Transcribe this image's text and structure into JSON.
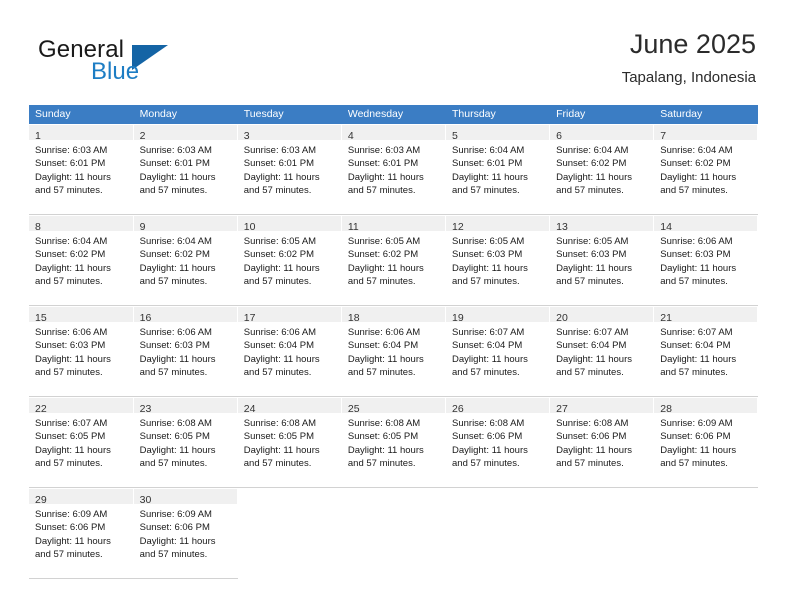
{
  "brand": {
    "name_top": "General",
    "name_bottom": "Blue",
    "flag_color": "#1464a5",
    "blue_color": "#1d7dc4"
  },
  "header": {
    "title": "June 2025",
    "subtitle": "Tapalang, Indonesia"
  },
  "calendar": {
    "header_bg": "#3b7dc4",
    "daynum_bg": "#f0f0f0",
    "weekday_headers": [
      "Sunday",
      "Monday",
      "Tuesday",
      "Wednesday",
      "Thursday",
      "Friday",
      "Saturday"
    ],
    "weeks": [
      [
        {
          "day": "1",
          "sunrise": "Sunrise: 6:03 AM",
          "sunset": "Sunset: 6:01 PM",
          "daylight1": "Daylight: 11 hours",
          "daylight2": "and 57 minutes."
        },
        {
          "day": "2",
          "sunrise": "Sunrise: 6:03 AM",
          "sunset": "Sunset: 6:01 PM",
          "daylight1": "Daylight: 11 hours",
          "daylight2": "and 57 minutes."
        },
        {
          "day": "3",
          "sunrise": "Sunrise: 6:03 AM",
          "sunset": "Sunset: 6:01 PM",
          "daylight1": "Daylight: 11 hours",
          "daylight2": "and 57 minutes."
        },
        {
          "day": "4",
          "sunrise": "Sunrise: 6:03 AM",
          "sunset": "Sunset: 6:01 PM",
          "daylight1": "Daylight: 11 hours",
          "daylight2": "and 57 minutes."
        },
        {
          "day": "5",
          "sunrise": "Sunrise: 6:04 AM",
          "sunset": "Sunset: 6:01 PM",
          "daylight1": "Daylight: 11 hours",
          "daylight2": "and 57 minutes."
        },
        {
          "day": "6",
          "sunrise": "Sunrise: 6:04 AM",
          "sunset": "Sunset: 6:02 PM",
          "daylight1": "Daylight: 11 hours",
          "daylight2": "and 57 minutes."
        },
        {
          "day": "7",
          "sunrise": "Sunrise: 6:04 AM",
          "sunset": "Sunset: 6:02 PM",
          "daylight1": "Daylight: 11 hours",
          "daylight2": "and 57 minutes."
        }
      ],
      [
        {
          "day": "8",
          "sunrise": "Sunrise: 6:04 AM",
          "sunset": "Sunset: 6:02 PM",
          "daylight1": "Daylight: 11 hours",
          "daylight2": "and 57 minutes."
        },
        {
          "day": "9",
          "sunrise": "Sunrise: 6:04 AM",
          "sunset": "Sunset: 6:02 PM",
          "daylight1": "Daylight: 11 hours",
          "daylight2": "and 57 minutes."
        },
        {
          "day": "10",
          "sunrise": "Sunrise: 6:05 AM",
          "sunset": "Sunset: 6:02 PM",
          "daylight1": "Daylight: 11 hours",
          "daylight2": "and 57 minutes."
        },
        {
          "day": "11",
          "sunrise": "Sunrise: 6:05 AM",
          "sunset": "Sunset: 6:02 PM",
          "daylight1": "Daylight: 11 hours",
          "daylight2": "and 57 minutes."
        },
        {
          "day": "12",
          "sunrise": "Sunrise: 6:05 AM",
          "sunset": "Sunset: 6:03 PM",
          "daylight1": "Daylight: 11 hours",
          "daylight2": "and 57 minutes."
        },
        {
          "day": "13",
          "sunrise": "Sunrise: 6:05 AM",
          "sunset": "Sunset: 6:03 PM",
          "daylight1": "Daylight: 11 hours",
          "daylight2": "and 57 minutes."
        },
        {
          "day": "14",
          "sunrise": "Sunrise: 6:06 AM",
          "sunset": "Sunset: 6:03 PM",
          "daylight1": "Daylight: 11 hours",
          "daylight2": "and 57 minutes."
        }
      ],
      [
        {
          "day": "15",
          "sunrise": "Sunrise: 6:06 AM",
          "sunset": "Sunset: 6:03 PM",
          "daylight1": "Daylight: 11 hours",
          "daylight2": "and 57 minutes."
        },
        {
          "day": "16",
          "sunrise": "Sunrise: 6:06 AM",
          "sunset": "Sunset: 6:03 PM",
          "daylight1": "Daylight: 11 hours",
          "daylight2": "and 57 minutes."
        },
        {
          "day": "17",
          "sunrise": "Sunrise: 6:06 AM",
          "sunset": "Sunset: 6:04 PM",
          "daylight1": "Daylight: 11 hours",
          "daylight2": "and 57 minutes."
        },
        {
          "day": "18",
          "sunrise": "Sunrise: 6:06 AM",
          "sunset": "Sunset: 6:04 PM",
          "daylight1": "Daylight: 11 hours",
          "daylight2": "and 57 minutes."
        },
        {
          "day": "19",
          "sunrise": "Sunrise: 6:07 AM",
          "sunset": "Sunset: 6:04 PM",
          "daylight1": "Daylight: 11 hours",
          "daylight2": "and 57 minutes."
        },
        {
          "day": "20",
          "sunrise": "Sunrise: 6:07 AM",
          "sunset": "Sunset: 6:04 PM",
          "daylight1": "Daylight: 11 hours",
          "daylight2": "and 57 minutes."
        },
        {
          "day": "21",
          "sunrise": "Sunrise: 6:07 AM",
          "sunset": "Sunset: 6:04 PM",
          "daylight1": "Daylight: 11 hours",
          "daylight2": "and 57 minutes."
        }
      ],
      [
        {
          "day": "22",
          "sunrise": "Sunrise: 6:07 AM",
          "sunset": "Sunset: 6:05 PM",
          "daylight1": "Daylight: 11 hours",
          "daylight2": "and 57 minutes."
        },
        {
          "day": "23",
          "sunrise": "Sunrise: 6:08 AM",
          "sunset": "Sunset: 6:05 PM",
          "daylight1": "Daylight: 11 hours",
          "daylight2": "and 57 minutes."
        },
        {
          "day": "24",
          "sunrise": "Sunrise: 6:08 AM",
          "sunset": "Sunset: 6:05 PM",
          "daylight1": "Daylight: 11 hours",
          "daylight2": "and 57 minutes."
        },
        {
          "day": "25",
          "sunrise": "Sunrise: 6:08 AM",
          "sunset": "Sunset: 6:05 PM",
          "daylight1": "Daylight: 11 hours",
          "daylight2": "and 57 minutes."
        },
        {
          "day": "26",
          "sunrise": "Sunrise: 6:08 AM",
          "sunset": "Sunset: 6:06 PM",
          "daylight1": "Daylight: 11 hours",
          "daylight2": "and 57 minutes."
        },
        {
          "day": "27",
          "sunrise": "Sunrise: 6:08 AM",
          "sunset": "Sunset: 6:06 PM",
          "daylight1": "Daylight: 11 hours",
          "daylight2": "and 57 minutes."
        },
        {
          "day": "28",
          "sunrise": "Sunrise: 6:09 AM",
          "sunset": "Sunset: 6:06 PM",
          "daylight1": "Daylight: 11 hours",
          "daylight2": "and 57 minutes."
        }
      ],
      [
        {
          "day": "29",
          "sunrise": "Sunrise: 6:09 AM",
          "sunset": "Sunset: 6:06 PM",
          "daylight1": "Daylight: 11 hours",
          "daylight2": "and 57 minutes."
        },
        {
          "day": "30",
          "sunrise": "Sunrise: 6:09 AM",
          "sunset": "Sunset: 6:06 PM",
          "daylight1": "Daylight: 11 hours",
          "daylight2": "and 57 minutes."
        },
        null,
        null,
        null,
        null,
        null
      ]
    ]
  }
}
